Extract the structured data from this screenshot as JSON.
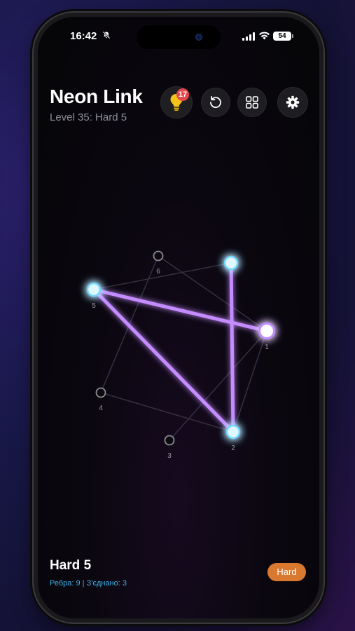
{
  "status_bar": {
    "time": "16:42",
    "battery": "54"
  },
  "header": {
    "title": "Neon Link",
    "subtitle": "Level 35: Hard 5"
  },
  "toolbar": {
    "hint_count": "17"
  },
  "nodes": [
    {
      "label": "1",
      "active": true,
      "endpoint": true
    },
    {
      "label": "2",
      "active": true
    },
    {
      "label": "3",
      "active": false
    },
    {
      "label": "4",
      "active": false
    },
    {
      "label": "5",
      "active": true
    },
    {
      "label": "6",
      "active": false
    },
    {
      "label": "",
      "active": true
    }
  ],
  "footer": {
    "title": "Hard 5",
    "stats": "Ребра: 9 | З'єднано: 3",
    "difficulty": "Hard"
  },
  "colors": {
    "neon_line": "#c58cff",
    "node_glow": "#9be7ff",
    "accent_orange": "#d9782f",
    "badge_red": "#e5484d",
    "stats_blue": "#3fb3e8"
  }
}
